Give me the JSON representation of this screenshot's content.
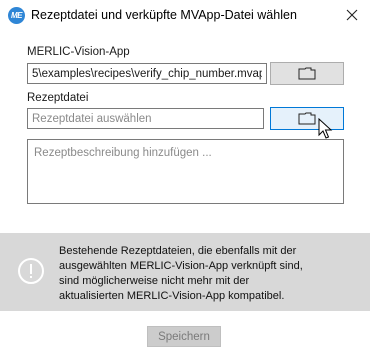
{
  "window": {
    "logo_text": "ME",
    "title": "Rezeptdatei und verküpfte MVApp-Datei wählen",
    "close_icon": "close-icon"
  },
  "mvapp": {
    "label": "MERLIC-Vision-App",
    "path_value": "5\\examples\\recipes\\verify_chip_number.mvapp",
    "browse_icon": "folder-icon"
  },
  "recipe": {
    "label": "Rezeptdatei",
    "placeholder": "Rezeptdatei auswählen",
    "value": "",
    "browse_icon": "folder-icon"
  },
  "description": {
    "placeholder": "Rezeptbeschreibung hinzufügen ...",
    "value": ""
  },
  "warning": {
    "icon": "info-icon",
    "lines": [
      "Bestehende Rezeptdateien, die ebenfalls mit der",
      "ausgewählten MERLIC-Vision-App verknüpft sind,",
      "sind möglicherweise nicht mehr mit der",
      "aktualisierten MERLIC-Vision-App kompatibel."
    ],
    "background": "#d8d8d8"
  },
  "footer": {
    "save_label": "Speichern",
    "save_enabled": false
  },
  "colors": {
    "accent": "#2f86d6",
    "button_hover_border": "#0078d7"
  }
}
